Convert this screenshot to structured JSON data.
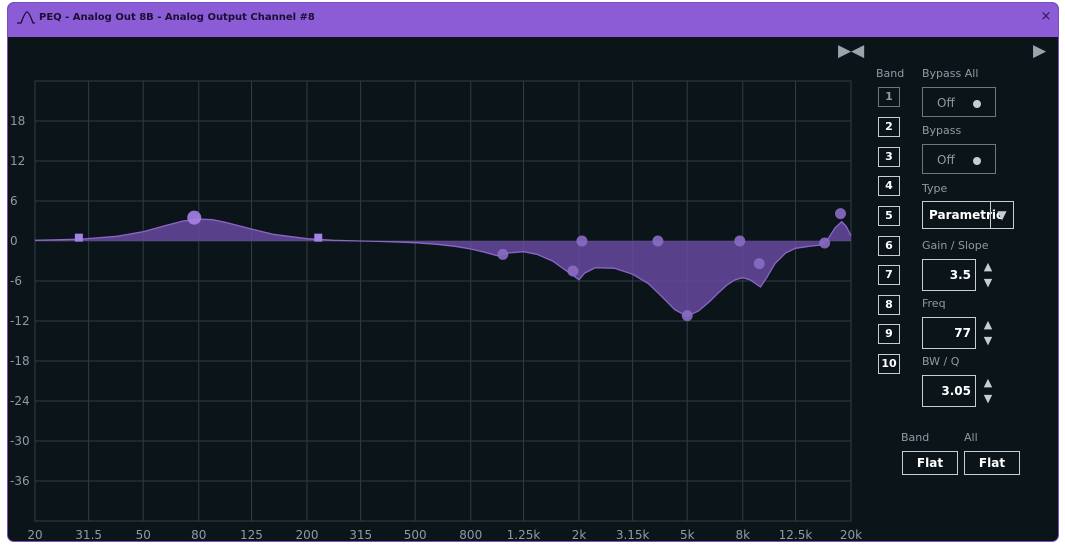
{
  "window": {
    "title": "PEQ - Analog Out 8B - Analog Output Channel #8",
    "close_symbol": "×",
    "icons": {
      "app": "peq-curve-icon",
      "close": "close-icon",
      "collapse": "collapse-arrows-icon",
      "expand": "expand-arrow-icon"
    }
  },
  "graph": {
    "y_ticks": [
      "18",
      "12",
      "6",
      "0",
      "-6",
      "-12",
      "-18",
      "-24",
      "-30",
      "-36"
    ],
    "y_values": [
      18,
      12,
      6,
      0,
      -6,
      -12,
      -18,
      -24,
      -30,
      -36
    ],
    "x_ticks": [
      "20",
      "31.5",
      "50",
      "80",
      "125",
      "200",
      "315",
      "500",
      "800",
      "1.25k",
      "2k",
      "3.15k",
      "5k",
      "8k",
      "12.5k",
      "20k"
    ],
    "x_values": [
      20,
      31.5,
      50,
      80,
      125,
      200,
      315,
      500,
      800,
      1250,
      2000,
      3150,
      5000,
      8000,
      12500,
      20000
    ],
    "y_range_db": [
      -42,
      24
    ],
    "x_range_hz": [
      20,
      20000
    ],
    "x_scale": "log",
    "grid": true,
    "colors": {
      "background": "#0b1419",
      "grid": "#2f3d45",
      "curve_fill": "#6a4aa3",
      "curve_stroke": "#8a66c6",
      "handle": "#a582e6",
      "handle_inactive": "#5b4490",
      "tick_text": "#8f9aa3"
    },
    "response_curve": [
      [
        20,
        0.1
      ],
      [
        25,
        0.2
      ],
      [
        30,
        0.3
      ],
      [
        40,
        0.7
      ],
      [
        50,
        1.4
      ],
      [
        60,
        2.3
      ],
      [
        70,
        3.0
      ],
      [
        80,
        3.3
      ],
      [
        90,
        3.2
      ],
      [
        100,
        2.8
      ],
      [
        125,
        1.8
      ],
      [
        150,
        1.0
      ],
      [
        200,
        0.35
      ],
      [
        250,
        0.1
      ],
      [
        315,
        0.0
      ],
      [
        400,
        -0.1
      ],
      [
        500,
        -0.25
      ],
      [
        600,
        -0.5
      ],
      [
        700,
        -0.8
      ],
      [
        800,
        -1.2
      ],
      [
        900,
        -1.7
      ],
      [
        1000,
        -2.2
      ],
      [
        1100,
        -1.8
      ],
      [
        1250,
        -1.6
      ],
      [
        1400,
        -2.0
      ],
      [
        1600,
        -3.0
      ],
      [
        1800,
        -4.5
      ],
      [
        2000,
        -5.8
      ],
      [
        2100,
        -4.8
      ],
      [
        2300,
        -4.0
      ],
      [
        2700,
        -4.1
      ],
      [
        3150,
        -5.0
      ],
      [
        3600,
        -6.4
      ],
      [
        4000,
        -8.2
      ],
      [
        4500,
        -10.3
      ],
      [
        5000,
        -11.3
      ],
      [
        5500,
        -10.5
      ],
      [
        6000,
        -9.2
      ],
      [
        6500,
        -7.8
      ],
      [
        7000,
        -6.6
      ],
      [
        7500,
        -5.8
      ],
      [
        8000,
        -5.5
      ],
      [
        8500,
        -5.8
      ],
      [
        9000,
        -6.5
      ],
      [
        9300,
        -6.9
      ],
      [
        9800,
        -5.5
      ],
      [
        10500,
        -3.4
      ],
      [
        11500,
        -1.8
      ],
      [
        12500,
        -1.1
      ],
      [
        14000,
        -0.8
      ],
      [
        15500,
        -0.6
      ],
      [
        16500,
        0.4
      ],
      [
        17500,
        2.0
      ],
      [
        18500,
        2.9
      ],
      [
        19200,
        2.2
      ],
      [
        20000,
        0.8
      ]
    ],
    "band_handles": [
      {
        "band": "1",
        "freq": 29,
        "gain": 0.5,
        "shape": "square"
      },
      {
        "band": "2",
        "freq": 77,
        "gain": 3.5,
        "shape": "circle-large"
      },
      {
        "band": "3",
        "freq": 220,
        "gain": 0.5,
        "shape": "square"
      },
      {
        "band": "4",
        "freq": 1050,
        "gain": -2.0,
        "shape": "circle"
      },
      {
        "band": "5",
        "freq": 1900,
        "gain": -4.5,
        "shape": "circle"
      },
      {
        "band": "6",
        "freq": 2050,
        "gain": 0.0,
        "shape": "circle"
      },
      {
        "band": "7",
        "freq": 3900,
        "gain": 0.0,
        "shape": "circle"
      },
      {
        "band": "8",
        "freq": 5000,
        "gain": -11.2,
        "shape": "circle"
      },
      {
        "band": "9",
        "freq": 7800,
        "gain": 0.0,
        "shape": "circle"
      },
      {
        "band": "10",
        "freq": 9200,
        "gain": -3.4,
        "shape": "circle"
      },
      {
        "band": "11",
        "freq": 16000,
        "gain": -0.3,
        "shape": "circle"
      },
      {
        "band": "12",
        "freq": 18300,
        "gain": 4.1,
        "shape": "circle"
      }
    ]
  },
  "panel": {
    "band_label": "Band",
    "bands": [
      "1",
      "2",
      "3",
      "4",
      "5",
      "6",
      "7",
      "8",
      "9",
      "10"
    ],
    "bypass_all_label": "Bypass All",
    "bypass_all_value": "Off",
    "bypass_label": "Bypass",
    "bypass_value": "Off",
    "type_label": "Type",
    "type_value": "Parametric",
    "type_arrow": "▼",
    "gain_label": "Gain / Slope",
    "gain_value": "3.5",
    "freq_label": "Freq",
    "freq_value": "77",
    "bw_label": "BW / Q",
    "bw_value": "3.05",
    "spin_up": "▲",
    "spin_down": "▼",
    "flat_band_header": "Band",
    "flat_all_header": "All",
    "flat_band_button": "Flat",
    "flat_all_button": "Flat",
    "collapse_symbol": "▶◀",
    "expand_symbol": "▶"
  }
}
